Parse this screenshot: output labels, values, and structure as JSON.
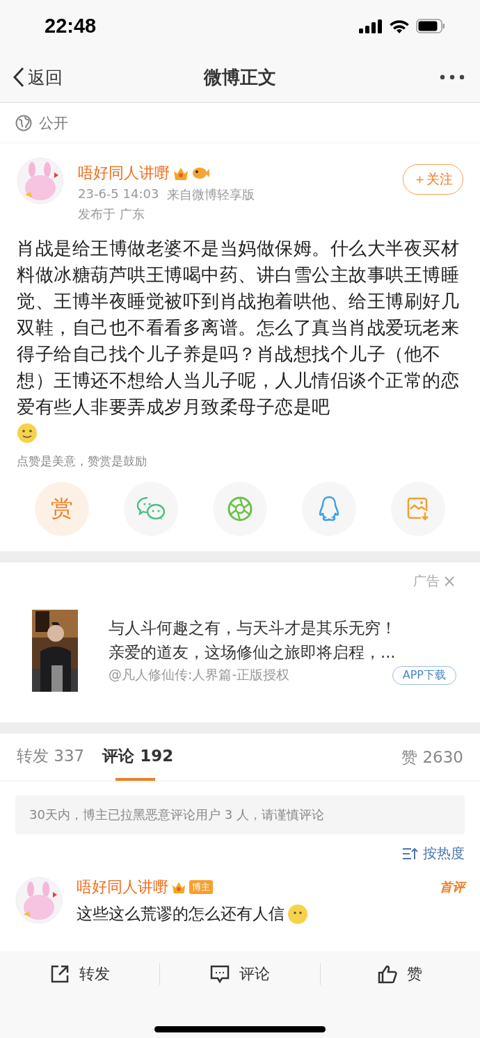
{
  "status_bar": {
    "time": "22:48"
  },
  "nav": {
    "back": "返回",
    "title": "微博正文"
  },
  "visibility": "公开",
  "post": {
    "author": "唔好同人讲嘢",
    "time": "23-6-5 14:03",
    "source": "来自微博轻享版",
    "location": "发布于 广东",
    "follow": "＋关注",
    "text": "肖战是给王博做老婆不是当妈做保姆。什么大半夜买材料做冰糖葫芦哄王博喝中药、讲白雪公主故事哄王博睡觉、王博半夜睡觉被吓到肖战抱着哄他、给王博刷好几双鞋，自己也不看看多离谱。怎么了真当肖战爱玩老来得子给自己找个儿子养是吗？肖战想找个儿子（他不想）王博还不想给人当儿子呢，人儿情侣谈个正常的恋爱有些人非要弄成岁月致柔母子恋是吧"
  },
  "reward_hint": "点赞是美意，赞赏是鼓励",
  "share": [
    {
      "kind": "reward",
      "label": "赏"
    },
    {
      "kind": "wechat"
    },
    {
      "kind": "moments"
    },
    {
      "kind": "qq"
    },
    {
      "kind": "save"
    }
  ],
  "ad": {
    "tag": "广告",
    "close": "×",
    "headline": "与人斗何趣之有，与天斗才是其乐无穷！",
    "line2": "亲爱的道友，这场修仙之旅即将启程，...",
    "source": "@凡人修仙传:人界篇-正版授权",
    "button": "APP下载"
  },
  "tabs": [
    {
      "label": "转发",
      "count": "337",
      "selected": false
    },
    {
      "label": "评论",
      "count": "192",
      "selected": true
    }
  ],
  "likes": {
    "label": "赞",
    "count": "2630"
  },
  "notice": "30天内，博主已拉黑恶意评论用户 3 人，请谨慎评论",
  "sort": "按热度",
  "comments": [
    {
      "author": "唔好同人讲嘢",
      "badge": "博主",
      "tag": "首评",
      "text": "这些这么荒谬的怎么还有人信"
    }
  ],
  "bottom_bar": [
    {
      "kind": "repost",
      "label": "转发"
    },
    {
      "kind": "comment",
      "label": "评论"
    },
    {
      "kind": "like",
      "label": "赞"
    }
  ]
}
